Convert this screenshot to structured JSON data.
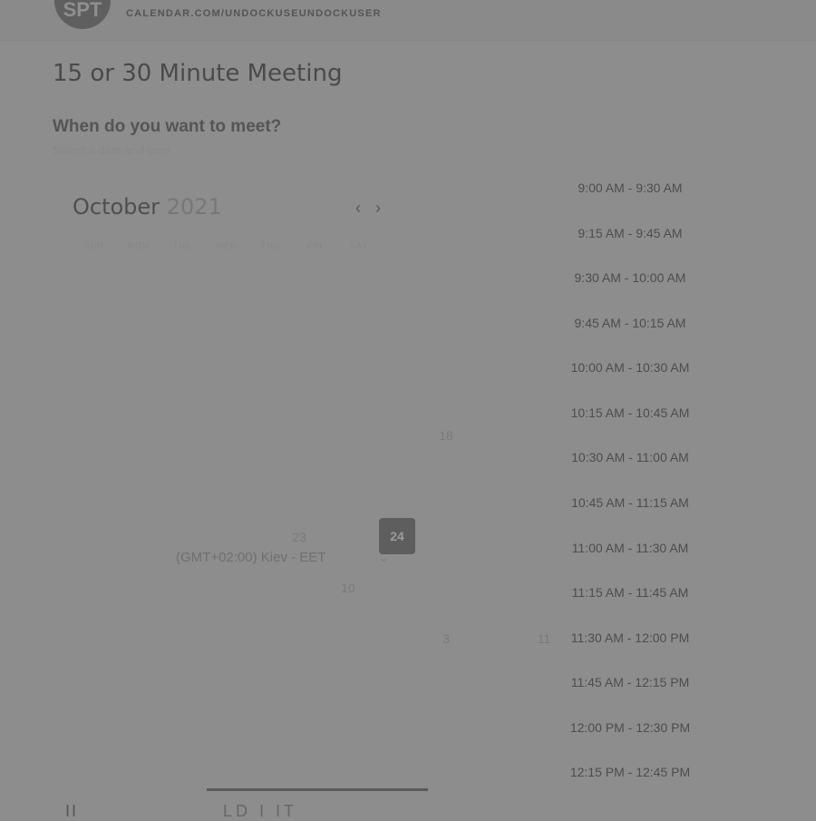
{
  "host": {
    "initials": "SPT",
    "url": "CALENDAR.COM/UNDOCKUSEUNDOCKUSER"
  },
  "meeting_title": "15 or 30 Minute Meeting",
  "prompt": {
    "question": "When do you want to meet?",
    "subtext": "Select a date and time"
  },
  "calendar": {
    "month": "October",
    "year": "2021",
    "prev_icon": "chevron-left-icon",
    "next_icon": "chevron-right-icon",
    "weekdays": [
      "SUN",
      "MON",
      "TUE",
      "WED",
      "THU",
      "FRI",
      "SAT"
    ],
    "visible_days": [
      "18",
      "23",
      "24",
      "10",
      "3",
      "11"
    ],
    "selected_day": "24"
  },
  "timezone": {
    "label": "(GMT+02:00) Kiev - EET",
    "caret_icon": "chevron-down-icon"
  },
  "time_slots": [
    "9:00 AM - 9:30 AM",
    "9:15 AM - 9:45 AM",
    "9:30 AM - 10:00 AM",
    "9:45 AM - 10:15 AM",
    "10:00 AM - 10:30 AM",
    "10:15 AM - 10:45 AM",
    "10:30 AM - 11:00 AM",
    "10:45 AM - 11:15 AM",
    "11:00 AM - 11:30 AM",
    "11:15 AM - 11:45 AM",
    "11:30 AM - 12:00 PM",
    "11:45 AM - 12:15 PM",
    "12:00 PM - 12:30 PM",
    "12:15 PM - 12:45 PM"
  ],
  "footer": {
    "left_text": "II",
    "mid_text": "LD I IT"
  }
}
